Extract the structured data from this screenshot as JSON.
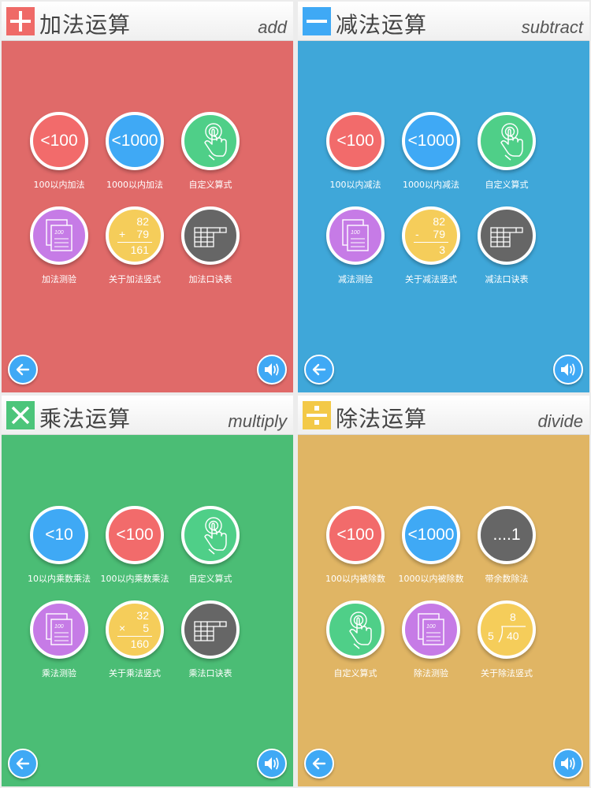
{
  "colors": {
    "add": "#e06a69",
    "subtract": "#3fa7d9",
    "multiply": "#4bbd75",
    "divide": "#e0b564",
    "red": "#f26b6b",
    "blue": "#3fa9f5",
    "green": "#4fcf88",
    "purple": "#c67be6",
    "yellow": "#f5cd5a",
    "gray": "#666666",
    "icon_add": "#ef6a67",
    "icon_subtract": "#3fa9f5",
    "icon_multiply": "#4cc57a",
    "icon_divide": "#f3c948"
  },
  "panels": [
    {
      "key": "add",
      "title": "加法运算",
      "subtitle": "add",
      "icon": "plus-icon",
      "tiles": [
        {
          "text": "<100",
          "label": "100以内加法",
          "color": "red",
          "kind": "text"
        },
        {
          "text": "<1000",
          "label": "1000以内加法",
          "color": "blue",
          "kind": "text"
        },
        {
          "label": "自定义算式",
          "color": "green",
          "kind": "hand",
          "icon": "pointing-hand-icon"
        },
        {
          "label": "加法测验",
          "color": "purple",
          "kind": "sheet",
          "icon": "test-sheet-icon",
          "sheet_text": "100"
        },
        {
          "label": "关于加法竖式",
          "color": "yellow",
          "kind": "vertical",
          "top": "82",
          "op": "+",
          "mid": "79",
          "res": "161"
        },
        {
          "label": "加法口诀表",
          "color": "gray",
          "kind": "table",
          "icon": "table-icon"
        }
      ]
    },
    {
      "key": "subtract",
      "title": "减法运算",
      "subtitle": "subtract",
      "icon": "minus-icon",
      "tiles": [
        {
          "text": "<100",
          "label": "100以内减法",
          "color": "red",
          "kind": "text"
        },
        {
          "text": "<1000",
          "label": "1000以内减法",
          "color": "blue",
          "kind": "text"
        },
        {
          "label": "自定义算式",
          "color": "green",
          "kind": "hand",
          "icon": "pointing-hand-icon"
        },
        {
          "label": "减法测验",
          "color": "purple",
          "kind": "sheet",
          "icon": "test-sheet-icon",
          "sheet_text": "100"
        },
        {
          "label": "关于减法竖式",
          "color": "yellow",
          "kind": "vertical",
          "top": "82",
          "op": "-",
          "mid": "79",
          "res": "3"
        },
        {
          "label": "减法口诀表",
          "color": "gray",
          "kind": "table",
          "icon": "table-icon"
        }
      ]
    },
    {
      "key": "multiply",
      "title": "乘法运算",
      "subtitle": "multiply",
      "icon": "times-icon",
      "tiles": [
        {
          "text": "<10",
          "label": "10以内乘数乘法",
          "color": "blue",
          "kind": "text"
        },
        {
          "text": "<100",
          "label": "100以内乘数乘法",
          "color": "red",
          "kind": "text"
        },
        {
          "label": "自定义算式",
          "color": "green",
          "kind": "hand",
          "icon": "pointing-hand-icon"
        },
        {
          "label": "乘法测验",
          "color": "purple",
          "kind": "sheet",
          "icon": "test-sheet-icon",
          "sheet_text": "100"
        },
        {
          "label": "关于乘法竖式",
          "color": "yellow",
          "kind": "vertical",
          "top": "32",
          "op": "×",
          "mid": "5",
          "res": "160"
        },
        {
          "label": "乘法口诀表",
          "color": "gray",
          "kind": "table",
          "icon": "table-icon"
        }
      ]
    },
    {
      "key": "divide",
      "title": "除法运算",
      "subtitle": "divide",
      "icon": "divide-icon",
      "tiles": [
        {
          "text": "<100",
          "label": "100以内被除数",
          "color": "red",
          "kind": "text"
        },
        {
          "text": "<1000",
          "label": "1000以内被除数",
          "color": "blue",
          "kind": "text"
        },
        {
          "text": "....1",
          "label": "带余数除法",
          "color": "gray",
          "kind": "text"
        },
        {
          "label": "自定义算式",
          "color": "green",
          "kind": "hand",
          "icon": "pointing-hand-icon"
        },
        {
          "label": "除法测验",
          "color": "purple",
          "kind": "sheet",
          "icon": "test-sheet-icon",
          "sheet_text": "100"
        },
        {
          "label": "关于除法竖式",
          "color": "yellow",
          "kind": "division",
          "quotient": "8",
          "divisor": "5",
          "dividend": "40"
        }
      ]
    }
  ],
  "buttons": {
    "back_icon": "back-arrow-icon",
    "sound_icon": "speaker-icon"
  }
}
